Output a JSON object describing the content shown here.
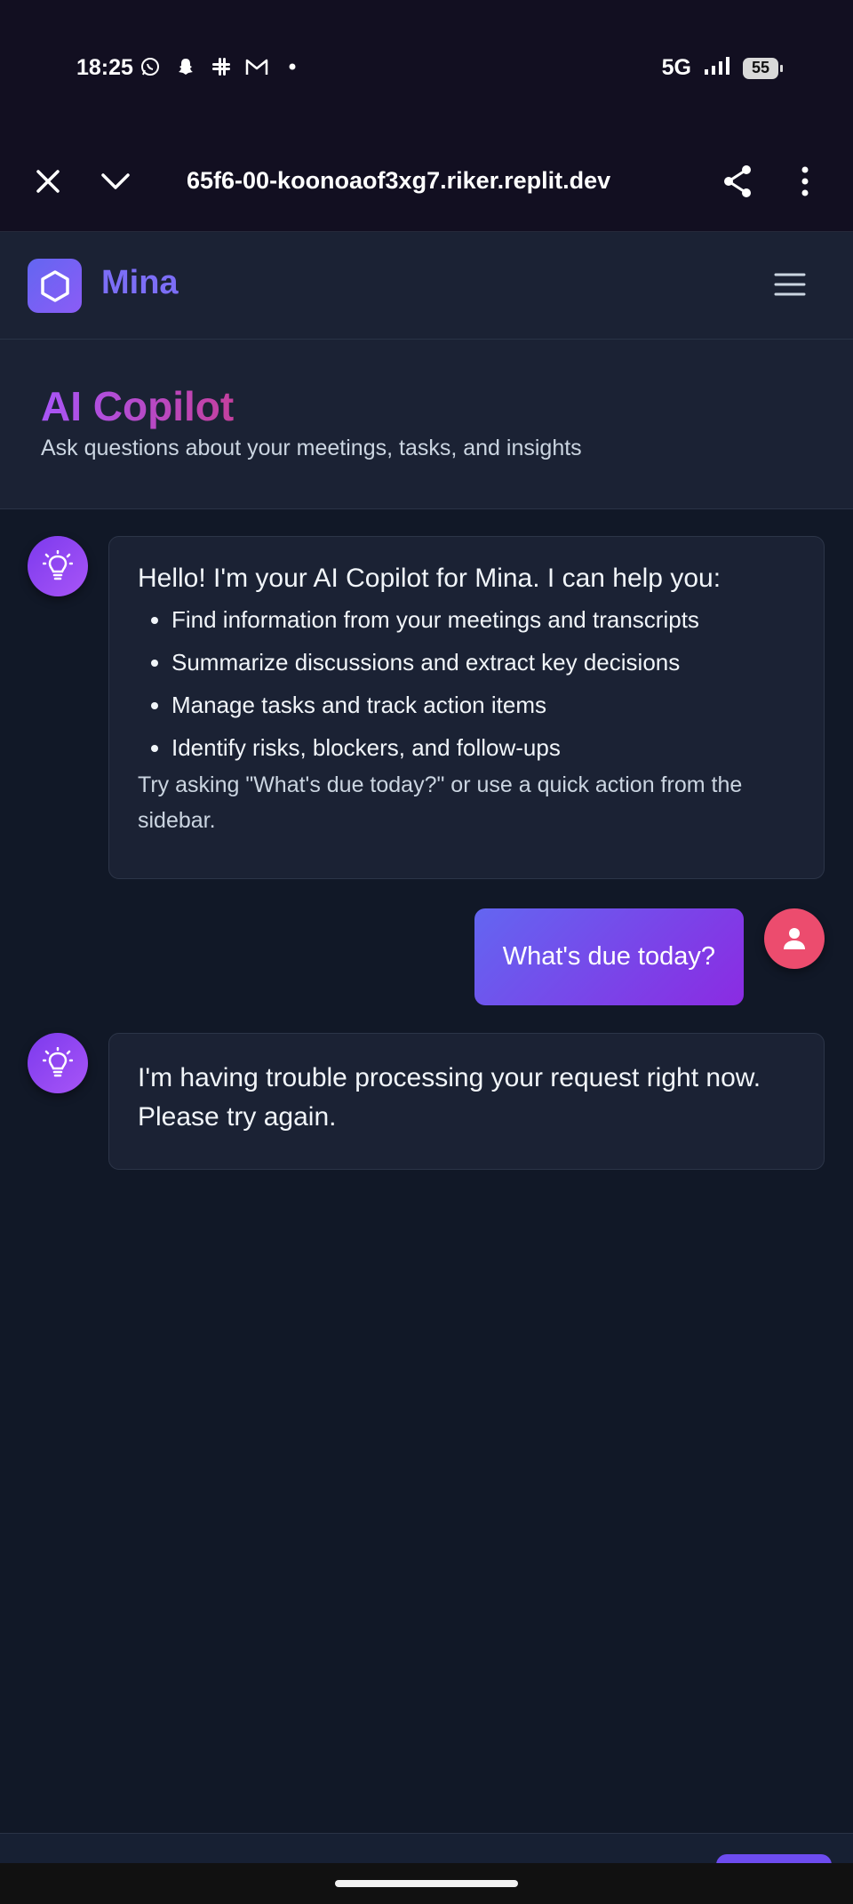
{
  "status_bar": {
    "time": "18:25",
    "notification_icons": [
      "whatsapp-icon",
      "snapchat-icon",
      "slack-icon",
      "gmail-icon",
      "dot-icon"
    ],
    "network": "5G",
    "battery": "55"
  },
  "browser": {
    "url": "65f6-00-koonoaof3xg7.riker.replit.dev"
  },
  "app": {
    "name": "Mina",
    "accent": "#6366f1"
  },
  "page": {
    "title": "AI Copilot",
    "subtitle": "Ask questions about your meetings, tasks, and insights"
  },
  "messages": [
    {
      "role": "assistant",
      "intro": "Hello! I'm your AI Copilot for Mina. I can help you:",
      "items": [
        "Find information from your meetings and transcripts",
        "Summarize discussions and extract key decisions",
        "Manage tasks and track action items",
        "Identify risks, blockers, and follow-ups"
      ],
      "hint": "Try asking \"What's due today?\" or use a quick action from the sidebar."
    },
    {
      "role": "user",
      "text": "What's due today?"
    },
    {
      "role": "assistant",
      "text": "I'm having trouble processing your request right now. Please try again."
    }
  ]
}
